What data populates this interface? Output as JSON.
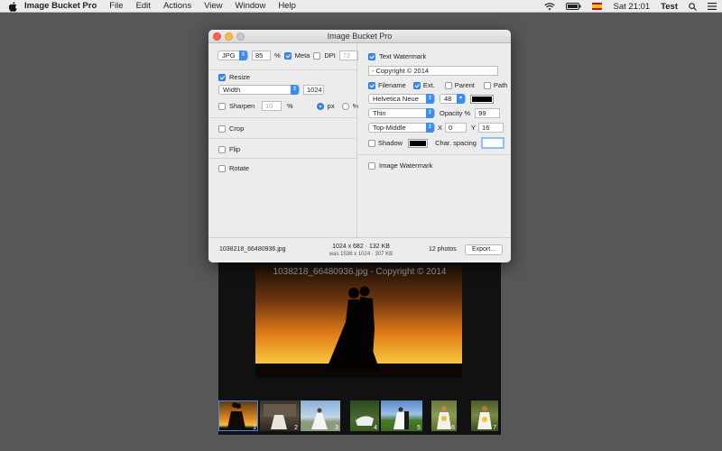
{
  "menubar": {
    "app_name": "Image Bucket Pro",
    "menus": [
      "File",
      "Edit",
      "Actions",
      "View",
      "Window",
      "Help"
    ],
    "clock": "Sat 21:01",
    "user": "Test",
    "icons": [
      "apple-icon",
      "wifi-icon",
      "battery-icon",
      "flag-icon",
      "search-icon",
      "list-icon"
    ]
  },
  "window": {
    "title": "Image Bucket Pro"
  },
  "left": {
    "format": "JPG",
    "quality": "85",
    "percent_sign": "%",
    "meta_label": "Meta",
    "meta_checked": true,
    "dpi_label": "DPI",
    "dpi_value": "72",
    "dpi_checked": false,
    "resize_label": "Resize",
    "resize_checked": true,
    "resize_mode": "Width",
    "resize_value": "1024",
    "sharpen_label": "Sharpen",
    "sharpen_value": "10",
    "sharpen_unit": "%",
    "unit_px": "px",
    "unit_percent": "%",
    "crop_label": "Crop",
    "flip_label": "Flip",
    "rotate_label": "Rotate"
  },
  "right": {
    "text_watermark_label": "Text Watermark",
    "text_watermark_checked": true,
    "watermark_text": "- Copyright © 2014",
    "filename_label": "Filename",
    "ext_label": "Ext.",
    "parent_label": "Parent",
    "path_label": "Path",
    "font": "Helvetica Neue",
    "font_size": "48",
    "color_swatch": "#000000",
    "weight": "Thin",
    "opacity_label": "Opacity %",
    "opacity_value": "99",
    "position": "Top-Middle",
    "x_label": "X",
    "x_value": "0",
    "y_label": "Y",
    "y_value": "16",
    "shadow_label": "Shadow",
    "shadow_color": "#000000",
    "char_spacing_label": "Char. spacing",
    "char_spacing_value": "",
    "image_watermark_label": "Image Watermark"
  },
  "status": {
    "filename": "1038218_66480936.jpg",
    "dims": "1024 x 682 · 132 KB",
    "was": "was 1536 x 1024 · 307 KB",
    "count": "12 photos",
    "export_label": "Export..."
  },
  "preview": {
    "watermark": "1038218_66480936.jpg - Copyright © 2014",
    "thumbnails": [
      "1",
      "2",
      "3",
      "4",
      "5",
      "6",
      "7"
    ]
  },
  "colors": {
    "accent": "#3b8df5",
    "desktop": "#575757"
  }
}
